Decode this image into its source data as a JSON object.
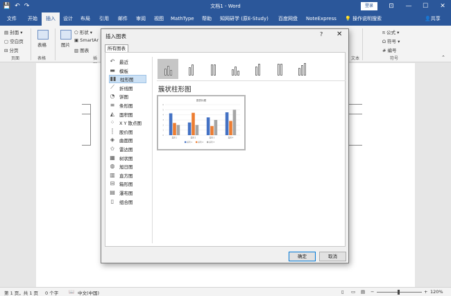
{
  "titlebar": {
    "document_title": "文档1 - Word",
    "login_label": "登录",
    "undo_icon": "↶",
    "redo_icon": "↷",
    "save_icon": "💾"
  },
  "tabs": [
    "文件",
    "开始",
    "插入",
    "设计",
    "布局",
    "引用",
    "邮件",
    "审阅",
    "视图",
    "MathType",
    "帮助",
    "知网研学 (原E-Study)",
    "百度网盘",
    "NoteExpress"
  ],
  "tell_me": "操作说明搜索",
  "share": "共享",
  "ribbon": {
    "cover": "封面",
    "blank_page": "空白页",
    "page_break": "分页",
    "pages_group": "页面",
    "table": "表格",
    "tables_group": "表格",
    "picture": "图片",
    "shapes": "形状",
    "smartart": "SmartAr",
    "chart": "图表",
    "illustrations_group": "插图",
    "formula": "公式",
    "symbol": "符号",
    "number": "编号",
    "symbols_group": "符号",
    "text_group": "文本"
  },
  "dialog": {
    "title": "插入图表",
    "help": "?",
    "close": "✕",
    "tab_label": "所有图表",
    "chart_types": [
      {
        "label": "最近",
        "icon": "↶"
      },
      {
        "label": "模板",
        "icon": "▬"
      },
      {
        "label": "柱形图",
        "icon": "▮▮"
      },
      {
        "label": "折线图",
        "icon": "⟋"
      },
      {
        "label": "饼图",
        "icon": "◔"
      },
      {
        "label": "条形图",
        "icon": "≡"
      },
      {
        "label": "面积图",
        "icon": "◭"
      },
      {
        "label": "X Y 散点图",
        "icon": "⁘"
      },
      {
        "label": "股价图",
        "icon": "┆"
      },
      {
        "label": "曲面图",
        "icon": "◈"
      },
      {
        "label": "雷达图",
        "icon": "✩"
      },
      {
        "label": "树状图",
        "icon": "▦"
      },
      {
        "label": "旭日图",
        "icon": "◍"
      },
      {
        "label": "直方图",
        "icon": "▥"
      },
      {
        "label": "箱形图",
        "icon": "⊟"
      },
      {
        "label": "瀑布图",
        "icon": "▤"
      },
      {
        "label": "组合图",
        "icon": "▯"
      }
    ],
    "selected_type": "柱形图",
    "subtype_name": "簇状柱形图",
    "ok_label": "确定",
    "cancel_label": "取消"
  },
  "statusbar": {
    "page": "第 1 页，共 1 页",
    "words": "0 个字",
    "language": "中文(中国)",
    "zoom": "120%"
  },
  "chart_data": {
    "type": "bar",
    "title": "图表标题",
    "categories": [
      "类别 1",
      "类别 2",
      "类别 3",
      "类别 4"
    ],
    "series": [
      {
        "name": "系列 1",
        "values": [
          4.3,
          2.5,
          3.5,
          4.5
        ],
        "color": "#4472c4"
      },
      {
        "name": "系列 2",
        "values": [
          2.4,
          4.4,
          1.8,
          2.8
        ],
        "color": "#ed7d31"
      },
      {
        "name": "系列 3",
        "values": [
          2,
          2,
          3,
          5
        ],
        "color": "#a5a5a5"
      }
    ],
    "ylim": [
      0,
      6
    ],
    "grid": true,
    "legend_position": "bottom"
  }
}
